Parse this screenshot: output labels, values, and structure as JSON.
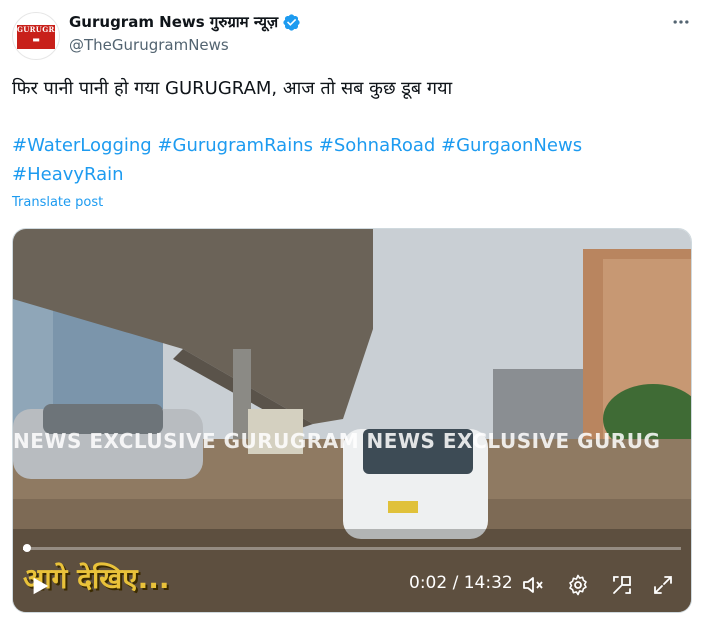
{
  "author": {
    "display_name": "Gurugram News गुरुग्राम न्यूज़",
    "handle": "@TheGurugramNews",
    "avatar_text": "GURUGRAM NEWS",
    "avatar_subtext": "सबसे अलग सबसे आगे",
    "verified_icon": "verified-badge-icon"
  },
  "post": {
    "text_line": "फिर पानी पानी हो गया GURUGRAM, आज तो सब कुछ डूब गया",
    "hashtags_line1": [
      "#WaterLogging",
      "#GurugramRains",
      "#SohnaRoad",
      "#GurgaonNews"
    ],
    "hashtags_line2": [
      "#HeavyRain"
    ],
    "translate_label": "Translate post"
  },
  "video": {
    "watermark": "NEWS EXCLUSIVE GURUGRAM NEWS EXCLUSIVE GURUG",
    "caption_overlay": "आगे देखिए...",
    "current_time": "0:02",
    "duration": "14:32",
    "time_display": "0:02 / 14:32",
    "progress_fraction": 0.0023,
    "controls": [
      "play-icon",
      "mute-icon",
      "settings-icon",
      "pip-icon",
      "fullscreen-icon"
    ]
  },
  "colors": {
    "link_blue": "#1d9bf0",
    "text_primary": "#0f1419",
    "text_secondary": "#536471",
    "verified_blue": "#1d9bf0",
    "caption_yellow": "#e9c23a"
  }
}
